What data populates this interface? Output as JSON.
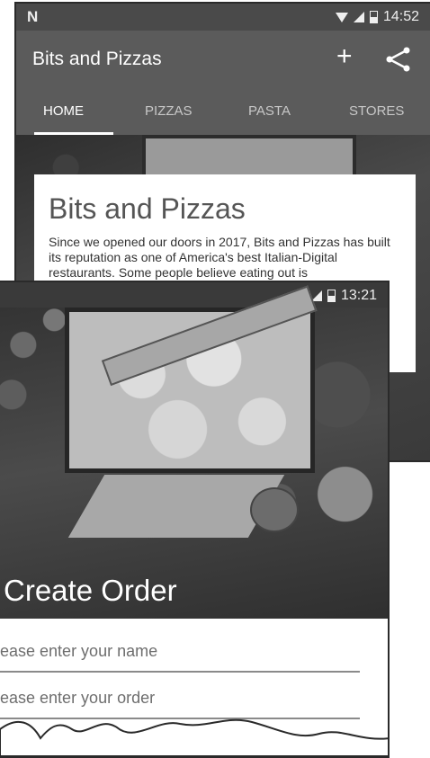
{
  "back_screen": {
    "status": {
      "carrier_icon": "N",
      "time": "14:52"
    },
    "app_title": "Bits and Pizzas",
    "actions": {
      "add_label": "+",
      "share_icon": "share-icon"
    },
    "tabs": [
      {
        "label": "HOME",
        "active": true
      },
      {
        "label": "PIZZAS",
        "active": false
      },
      {
        "label": "PASTA",
        "active": false
      },
      {
        "label": "STORES",
        "active": false
      }
    ],
    "card": {
      "title": "Bits and Pizzas",
      "text": "Since we opened our doors in 2017, Bits and Pizzas has built its reputation as one of America's best Italian-Digital restaurants. Some people believe eating out is"
    }
  },
  "front_screen": {
    "status": {
      "time": "13:21"
    },
    "hero_title": "Create Order",
    "form": {
      "name_placeholder": "lease enter your name",
      "order_placeholder": "lease enter your order"
    }
  },
  "colors": {
    "appbar": "#5b5b5b",
    "statusbar": "#4a4a4a",
    "underline": "#8a8a8a"
  }
}
